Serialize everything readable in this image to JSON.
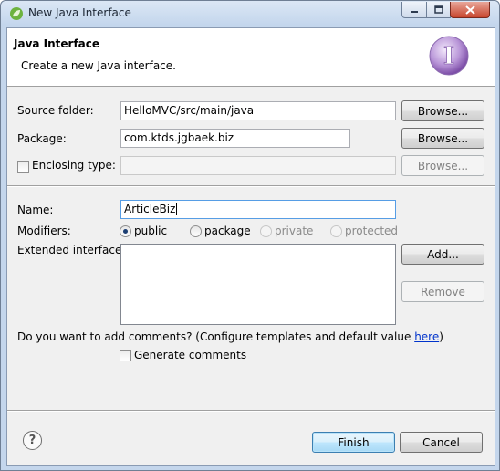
{
  "window": {
    "title": "New Java Interface",
    "controls": {
      "minimize": "minimize",
      "maximize": "maximize",
      "close": "close"
    }
  },
  "header": {
    "title": "Java Interface",
    "description": "Create a new Java interface.",
    "icon": "interface-wizard-icon",
    "icon_letter": "I"
  },
  "form": {
    "source_folder": {
      "label": "Source folder:",
      "value": "HelloMVC/src/main/java",
      "browse": "Browse..."
    },
    "package": {
      "label": "Package:",
      "value": "com.ktds.jgbaek.biz",
      "browse": "Browse..."
    },
    "enclosing_type": {
      "label": "Enclosing type:",
      "checked": false,
      "value": "",
      "browse": "Browse...",
      "enabled": false
    },
    "name": {
      "label": "Name:",
      "value": "ArticleBiz"
    },
    "modifiers": {
      "label": "Modifiers:",
      "options": [
        {
          "label": "public",
          "selected": true,
          "enabled": true
        },
        {
          "label": "package",
          "selected": false,
          "enabled": true
        },
        {
          "label": "private",
          "selected": false,
          "enabled": false
        },
        {
          "label": "protected",
          "selected": false,
          "enabled": false
        }
      ]
    },
    "extended_interfaces": {
      "label": "Extended interfaces:",
      "items": [],
      "add": "Add...",
      "remove": "Remove"
    },
    "comments": {
      "question_prefix": "Do you want to add comments? (Configure templates and default value ",
      "link": "here",
      "question_suffix": ")",
      "generate_label": "Generate comments",
      "generate_checked": false
    }
  },
  "footer": {
    "help": "?",
    "finish": "Finish",
    "cancel": "Cancel"
  },
  "colors": {
    "accent": "#3c7fb1",
    "link": "#0033cc",
    "icon_purple": "#9a6fc2"
  }
}
